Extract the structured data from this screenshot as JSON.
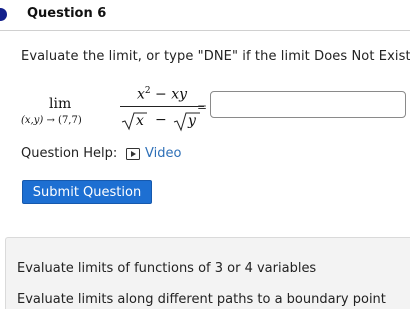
{
  "question": {
    "title": "Question 6",
    "prompt": "Evaluate the limit, or type \"DNE\" if the limit Does Not Exist:"
  },
  "limit": {
    "operator": "lim",
    "approach_vars": "(x,y)",
    "arrow": "→",
    "approach_point": "(7,7)",
    "numerator_base": "x",
    "numerator_exp": "2",
    "numerator_rest": "− xy",
    "denominator_left": "x",
    "denominator_op": "−",
    "denominator_right": "y",
    "equals": "="
  },
  "answer": {
    "value": "",
    "placeholder": ""
  },
  "help": {
    "label": "Question Help:",
    "video_label": "Video",
    "video_icon": "play-icon"
  },
  "submit": {
    "label": "Submit Question"
  },
  "skills": [
    "Evaluate limits of functions of 3 or 4 variables",
    "Evaluate limits along different paths to a boundary point"
  ],
  "colors": {
    "question_dot": "#13208c",
    "submit_button": "#1d6fd2",
    "link": "#2d6fb7",
    "skills_panel": "#f3f3f3"
  }
}
